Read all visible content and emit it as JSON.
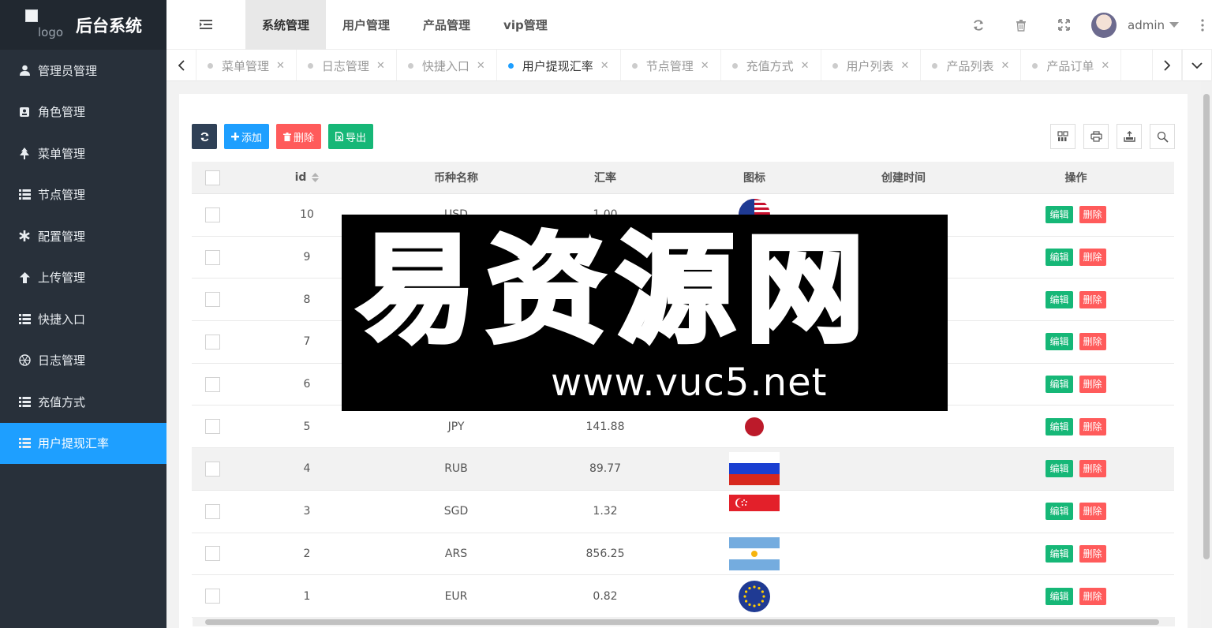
{
  "app": {
    "logo_alt": "logo",
    "title": "后台系统"
  },
  "sidebar": {
    "items": [
      {
        "label": "管理员管理",
        "icon": "user-icon",
        "active": false
      },
      {
        "label": "角色管理",
        "icon": "id-card-icon",
        "active": false
      },
      {
        "label": "菜单管理",
        "icon": "tree-icon",
        "active": false
      },
      {
        "label": "节点管理",
        "icon": "list-icon",
        "active": false
      },
      {
        "label": "配置管理",
        "icon": "asterisk-icon",
        "active": false
      },
      {
        "label": "上传管理",
        "icon": "arrow-up-icon",
        "active": false
      },
      {
        "label": "快捷入口",
        "icon": "list-icon",
        "active": false
      },
      {
        "label": "日志管理",
        "icon": "aperture-icon",
        "active": false
      },
      {
        "label": "充值方式",
        "icon": "list-icon",
        "active": false
      },
      {
        "label": "用户提现汇率",
        "icon": "list-icon",
        "active": true
      }
    ]
  },
  "header": {
    "nav": [
      {
        "label": "系统管理",
        "active": true
      },
      {
        "label": "用户管理",
        "active": false
      },
      {
        "label": "产品管理",
        "active": false
      },
      {
        "label": "vip管理",
        "active": false
      }
    ],
    "icons": [
      "refresh-icon",
      "trash-icon",
      "fullscreen-icon"
    ],
    "username": "admin"
  },
  "tabs": [
    {
      "label": "菜单管理",
      "active": false
    },
    {
      "label": "日志管理",
      "active": false
    },
    {
      "label": "快捷入口",
      "active": false
    },
    {
      "label": "用户提现汇率",
      "active": true
    },
    {
      "label": "节点管理",
      "active": false
    },
    {
      "label": "充值方式",
      "active": false
    },
    {
      "label": "用户列表",
      "active": false
    },
    {
      "label": "产品列表",
      "active": false
    },
    {
      "label": "产品订单",
      "active": false
    }
  ],
  "toolbar": {
    "add_label": "添加",
    "delete_label": "删除",
    "export_label": "导出"
  },
  "table": {
    "columns": [
      "id",
      "币种名称",
      "汇率",
      "图标",
      "创建时间",
      "操作"
    ],
    "edit_label": "编辑",
    "delete_label": "删除",
    "rows": [
      {
        "id": "10",
        "name": "USD",
        "rate": "1.00",
        "flag": "us-flag",
        "created": ""
      },
      {
        "id": "9",
        "name": "",
        "rate": "",
        "flag": "",
        "created": ""
      },
      {
        "id": "8",
        "name": "",
        "rate": "",
        "flag": "",
        "created": ""
      },
      {
        "id": "7",
        "name": "",
        "rate": "",
        "flag": "",
        "created": ""
      },
      {
        "id": "6",
        "name": "",
        "rate": "",
        "flag": "",
        "created": ""
      },
      {
        "id": "5",
        "name": "JPY",
        "rate": "141.88",
        "flag": "jp-flag",
        "created": ""
      },
      {
        "id": "4",
        "name": "RUB",
        "rate": "89.77",
        "flag": "ru-flag",
        "created": ""
      },
      {
        "id": "3",
        "name": "SGD",
        "rate": "1.32",
        "flag": "sg-flag",
        "created": ""
      },
      {
        "id": "2",
        "name": "ARS",
        "rate": "856.25",
        "flag": "ar-flag",
        "created": ""
      },
      {
        "id": "1",
        "name": "EUR",
        "rate": "0.82",
        "flag": "eu-flag",
        "created": ""
      }
    ]
  },
  "watermark": {
    "main": "易资源网",
    "url": "www.vuc5.net"
  },
  "colors": {
    "sidebar_bg": "#28303a",
    "accent": "#1e9fff",
    "success": "#16b777",
    "danger": "#ff5b5b"
  }
}
